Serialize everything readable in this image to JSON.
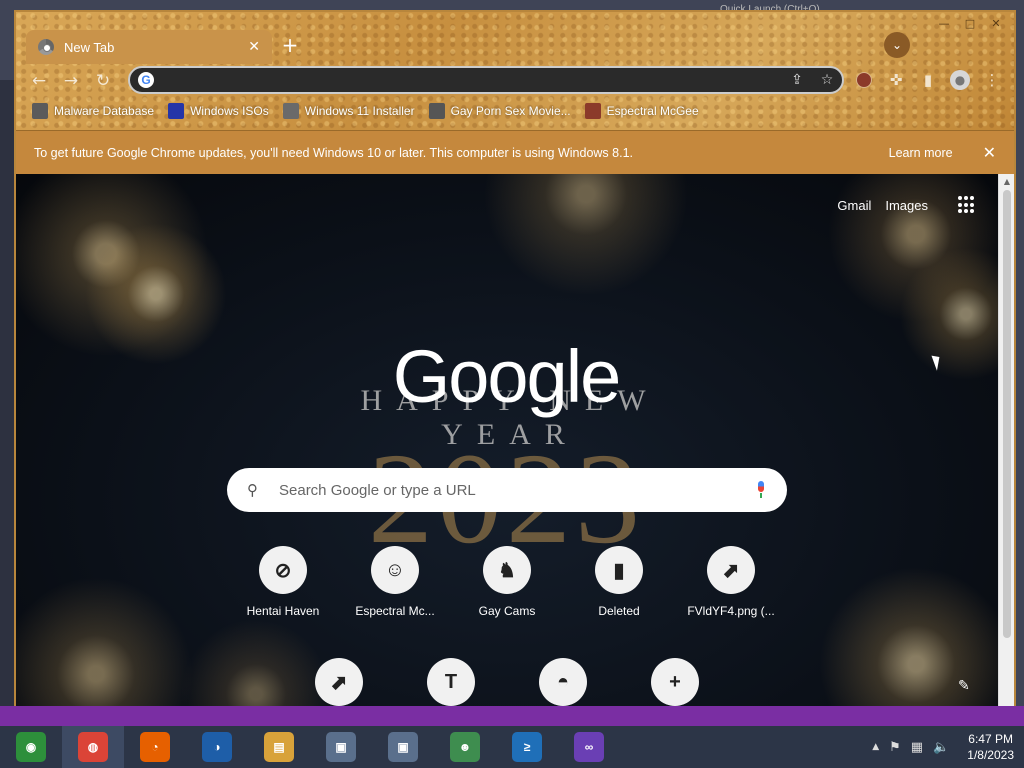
{
  "desktop": {
    "quick_launch": "Quick Launch (Ctrl+Q)"
  },
  "window": {
    "controls": {
      "minimize": "—",
      "maximize": "□",
      "close": "✕"
    }
  },
  "tab": {
    "title": "New Tab",
    "close": "✕",
    "new_tab": "+",
    "tab_search": "⌄"
  },
  "toolbar": {
    "back": "←",
    "forward": "→",
    "reload": "↻",
    "address_value": "",
    "share": "⇪",
    "star": "☆",
    "extensions": "✜",
    "sidebar": "▮",
    "menu": "⋮",
    "profile": "●"
  },
  "bookmarks": [
    {
      "label": "Malware Database",
      "icon": "malware-icon",
      "color": "#5b5b5b"
    },
    {
      "label": "Windows ISOs",
      "icon": "x-icon",
      "color": "#2535a8"
    },
    {
      "label": "Windows 11 Installer",
      "icon": "installer-icon",
      "color": "#6a6a6a"
    },
    {
      "label": "Gay Porn Sex Movie...",
      "icon": "site-icon",
      "color": "#555"
    },
    {
      "label": "Espectral McGee",
      "icon": "avatar-icon",
      "color": "#8b3a2a"
    }
  ],
  "infobar": {
    "message": "To get future Google Chrome updates, you'll need Windows 10 or later. This computer is using Windows 8.1.",
    "learn_more": "Learn more",
    "close": "✕"
  },
  "ntp": {
    "gmail": "Gmail",
    "images": "Images",
    "logo": "Google",
    "doodle_line1": "HAPPY NEW YEAR",
    "doodle_year": "2023",
    "search_placeholder": "Search Google or type a URL",
    "shortcuts": [
      {
        "label": "Hentai Haven",
        "glyph": "⊘",
        "icon": "site-icon"
      },
      {
        "label": "Espectral Mc...",
        "glyph": "☺",
        "icon": "avatar-icon"
      },
      {
        "label": "Gay Cams",
        "glyph": "♞",
        "icon": "site-icon"
      },
      {
        "label": "Deleted",
        "glyph": "▮",
        "icon": "site-icon"
      },
      {
        "label": "FVldYF4.png (...",
        "glyph": "⬈",
        "icon": "image-icon"
      },
      {
        "label": "",
        "glyph": "⬈",
        "icon": "image-icon"
      },
      {
        "label": "",
        "glyph": "T",
        "icon": "t-icon"
      },
      {
        "label": "",
        "glyph": "◓",
        "icon": "chrome-icon"
      },
      {
        "label": "",
        "glyph": "+",
        "icon": "add-shortcut-icon"
      }
    ],
    "customize": "✎"
  },
  "taskbar": {
    "items": [
      {
        "name": "task-item-maps",
        "glyph": "◉",
        "color": "#2d8f3b"
      },
      {
        "name": "task-item-chrome",
        "glyph": "◍",
        "color": "#db4437"
      },
      {
        "name": "task-item-firefox",
        "glyph": "◔",
        "color": "#e66000"
      },
      {
        "name": "task-item-obama",
        "glyph": "◑",
        "color": "#1e5ea8"
      },
      {
        "name": "task-item-explorer",
        "glyph": "▤",
        "color": "#d8a23a"
      },
      {
        "name": "task-item-remote1",
        "glyph": "▣",
        "color": "#5a6f8c"
      },
      {
        "name": "task-item-remote2",
        "glyph": "▣",
        "color": "#5a6f8c"
      },
      {
        "name": "task-item-users",
        "glyph": "☻",
        "color": "#3e8d4f"
      },
      {
        "name": "task-item-powershell",
        "glyph": "≥",
        "color": "#1f6fb8"
      },
      {
        "name": "task-item-visual-studio",
        "glyph": "∞",
        "color": "#6a3fb4"
      }
    ],
    "tray": {
      "chevron": "▲",
      "flag": "⚑",
      "network": "▦",
      "volume": "🔈"
    },
    "time": "6:47 PM",
    "date": "1/8/2023"
  }
}
